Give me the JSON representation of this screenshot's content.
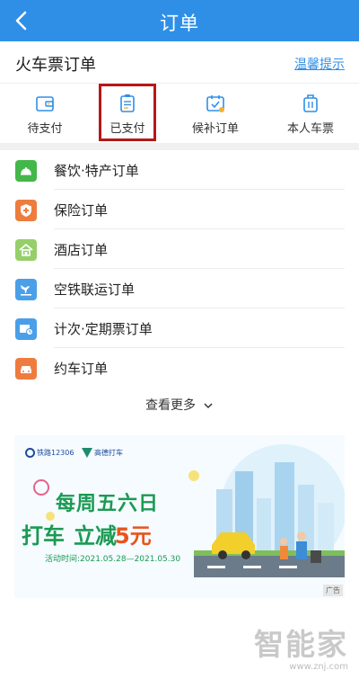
{
  "header": {
    "title": "订单"
  },
  "section": {
    "title": "火车票订单",
    "tip_link": "温馨提示"
  },
  "tabs": [
    {
      "label": "待支付",
      "icon": "wallet-icon"
    },
    {
      "label": "已支付",
      "icon": "receipt-icon"
    },
    {
      "label": "候补订单",
      "icon": "calendar-check-icon"
    },
    {
      "label": "本人车票",
      "icon": "suitcase-icon"
    }
  ],
  "order_types": [
    {
      "label": "餐饮·特产订单",
      "icon": "dining-cloche-icon",
      "color": "#44b74a"
    },
    {
      "label": "保险订单",
      "icon": "shield-icon",
      "color": "#ee7c3e"
    },
    {
      "label": "酒店订单",
      "icon": "hotel-icon",
      "color": "#96cf6a"
    },
    {
      "label": "空铁联运订单",
      "icon": "plane-train-icon",
      "color": "#4a9fe8"
    },
    {
      "label": "计次·定期票订单",
      "icon": "ticket-clock-icon",
      "color": "#4a9fe8"
    },
    {
      "label": "约车订单",
      "icon": "car-icon",
      "color": "#ee7c3e"
    }
  ],
  "more": {
    "label": "查看更多"
  },
  "ad": {
    "logo_left": "铁路12306",
    "logo_right": "高德打车",
    "headline_1": "每周五六日",
    "headline_2a": "打车",
    "headline_2b": "立减",
    "headline_2c": "5元",
    "date": "活动时间:2021.05.28—2021.05.30",
    "tag": "广告"
  },
  "watermark": {
    "main": "智能家",
    "sub": "www.znj.com"
  },
  "colors": {
    "brand": "#2f8fe6",
    "highlight_box": "#b51818",
    "ad_green": "#1b9a52",
    "ad_orange": "#e8541c"
  }
}
